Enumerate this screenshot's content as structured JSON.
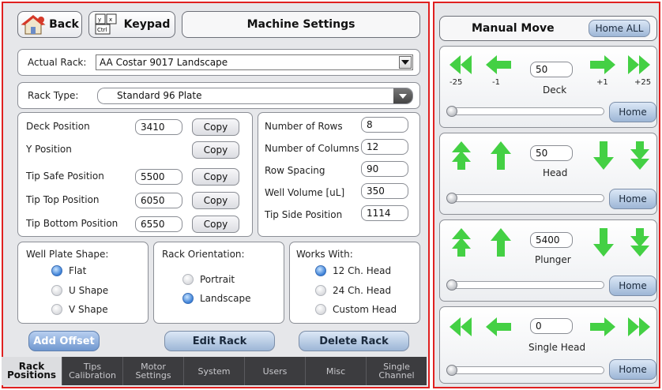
{
  "header": {
    "back_label": "Back",
    "keypad_label": "Keypad",
    "title": "Machine Settings"
  },
  "rack": {
    "actual_rack_label": "Actual Rack:",
    "actual_rack_value": "AA Costar 9017 Landscape",
    "rack_type_label": "Rack Type:",
    "rack_type_value": "Standard 96 Plate"
  },
  "positions": [
    {
      "label": "Deck Position",
      "value": "3410",
      "copy": "Copy"
    },
    {
      "label": "Y Position",
      "value": "",
      "copy": "Copy"
    },
    {
      "label": "Tip Safe Position",
      "value": "5500",
      "copy": "Copy"
    },
    {
      "label": "Tip Top Position",
      "value": "6050",
      "copy": "Copy"
    },
    {
      "label": "Tip Bottom Position",
      "value": "6550",
      "copy": "Copy"
    }
  ],
  "plate": [
    {
      "label": "Number of Rows",
      "value": "8"
    },
    {
      "label": "Number of Columns",
      "value": "12"
    },
    {
      "label": "Row Spacing",
      "value": "90"
    },
    {
      "label": "Well Volume [uL]",
      "value": "350"
    },
    {
      "label": "Tip Side Position",
      "value": "1114"
    }
  ],
  "shape": {
    "title": "Well Plate Shape:",
    "options": [
      "Flat",
      "U Shape",
      "V Shape"
    ],
    "selected": "Flat"
  },
  "orientation": {
    "title": "Rack Orientation:",
    "options": [
      "Portrait",
      "Landscape"
    ],
    "selected": "Landscape"
  },
  "works_with": {
    "title": "Works With:",
    "options": [
      "12 Ch. Head",
      "24 Ch. Head",
      "Custom Head"
    ],
    "selected": "12 Ch. Head"
  },
  "actions": {
    "add_offset": "Add Offset",
    "edit_rack": "Edit Rack",
    "delete_rack": "Delete Rack"
  },
  "tabs": [
    {
      "line1": "Rack",
      "line2": "Positions",
      "active": true
    },
    {
      "line1": "Tips",
      "line2": "Calibration",
      "active": false
    },
    {
      "line1": "Motor",
      "line2": "Settings",
      "active": false
    },
    {
      "line1": "System",
      "line2": "",
      "active": false
    },
    {
      "line1": "Users",
      "line2": "",
      "active": false
    },
    {
      "line1": "Misc",
      "line2": "",
      "active": false
    },
    {
      "line1": "Single",
      "line2": "Channel",
      "active": false
    }
  ],
  "manual_move": {
    "title": "Manual Move",
    "home_all": "Home ALL",
    "home_label": "Home",
    "deck": {
      "name": "Deck",
      "value": "50",
      "steps": [
        "-25",
        "-1",
        "+1",
        "+25"
      ],
      "slider": 0
    },
    "head": {
      "name": "Head",
      "value": "50",
      "slider": 0
    },
    "plunger": {
      "name": "Plunger",
      "value": "5400",
      "slider": 0
    },
    "single_head": {
      "name": "Single Head",
      "value": "0",
      "slider": 0
    }
  },
  "colors": {
    "panel_border": "#e02020",
    "arrow_green": "#3fcf3f",
    "tab_bar": "#3c3c3f",
    "radio_on": "#3b7fd6"
  },
  "icons": {
    "back": "house-icon",
    "keypad": "keyboard-icon",
    "dropdown": "chevron-down-icon",
    "arrows": [
      "double-left-arrow-icon",
      "left-arrow-icon",
      "right-arrow-icon",
      "double-right-arrow-icon",
      "double-up-arrow-icon",
      "up-arrow-icon",
      "down-arrow-icon",
      "double-down-arrow-icon"
    ]
  }
}
